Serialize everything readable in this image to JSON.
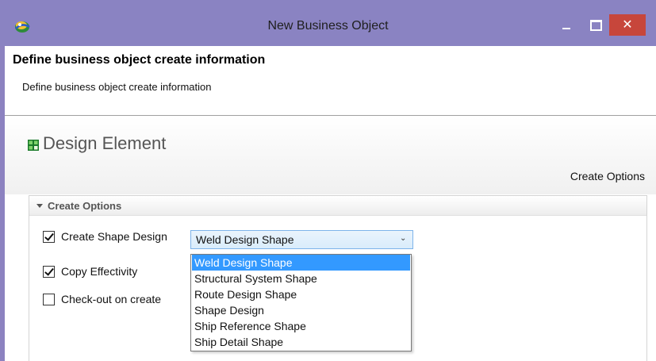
{
  "window": {
    "title": "New Business Object",
    "close_glyph": "✕"
  },
  "header": {
    "title": "Define business object create information",
    "description": "Define business object create information"
  },
  "section": {
    "icon": "design-element-icon",
    "title": "Design Element",
    "options_link": "Create Options"
  },
  "panel": {
    "title": "Create Options"
  },
  "options": {
    "create_shape_design": {
      "label": "Create Shape Design",
      "checked": true
    },
    "copy_effectivity": {
      "label": "Copy Effectivity",
      "checked": true
    },
    "checkout_on_create": {
      "label": "Check-out on create",
      "checked": false
    }
  },
  "combo": {
    "value": "Weld Design Shape",
    "arrow": "⌄",
    "options": [
      "Weld Design Shape",
      "Structural System Shape",
      "Route Design Shape",
      "Shape Design",
      "Ship Reference Shape",
      "Ship Detail Shape"
    ],
    "selected_index": 0
  },
  "colors": {
    "titlebar": "#8a83c2",
    "close": "#c7463b",
    "selection": "#3399ff"
  }
}
